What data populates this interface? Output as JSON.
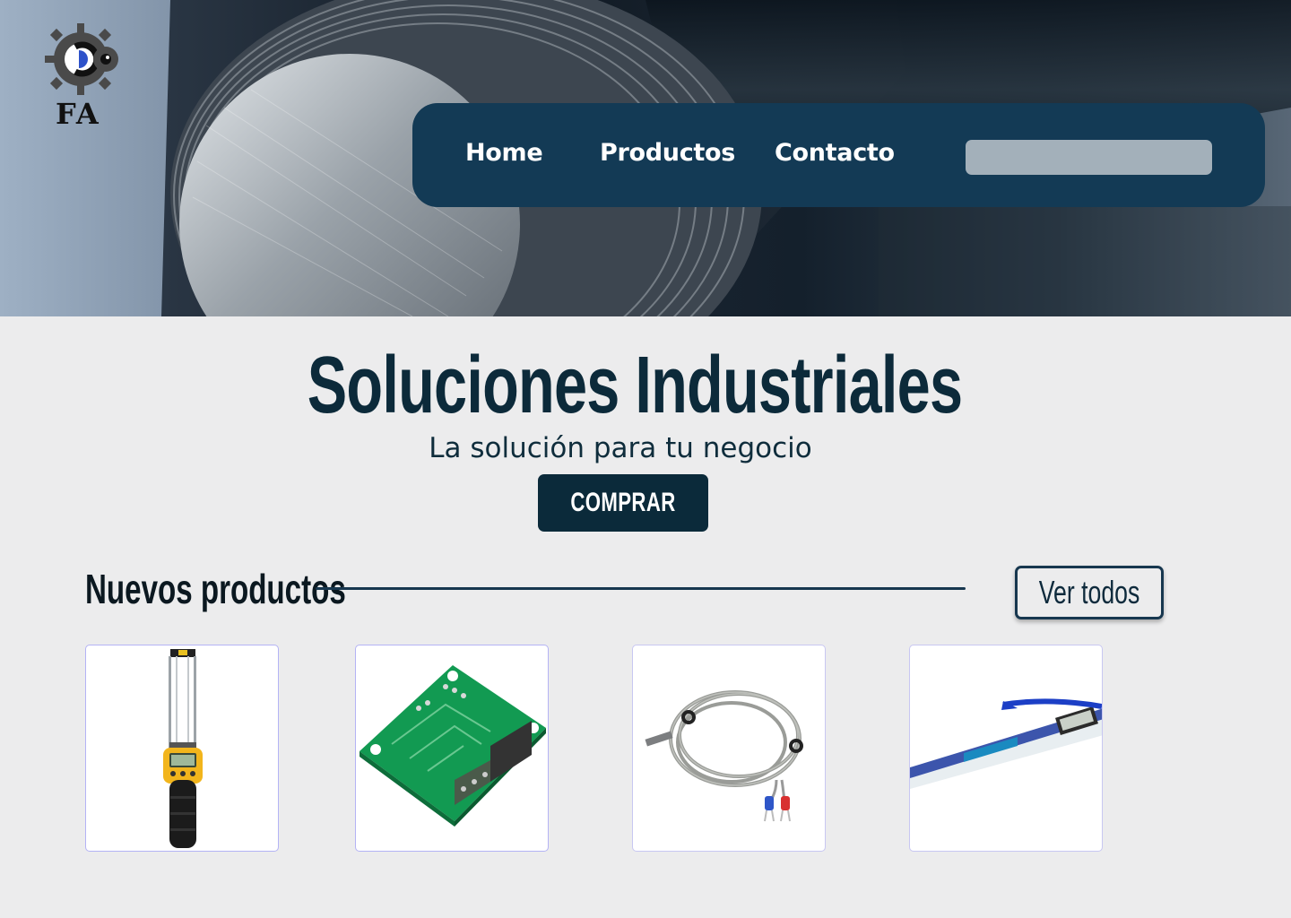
{
  "brand": {
    "logo_text": "FA"
  },
  "nav": {
    "items": [
      {
        "label": "Home"
      },
      {
        "label": "Productos"
      },
      {
        "label": "Contacto"
      }
    ],
    "search": {
      "value": "",
      "placeholder": ""
    }
  },
  "hero": {
    "title": "Soluciones Industriales",
    "subtitle": "La solución para tu negocio",
    "cta_label": "COMPRAR"
  },
  "new_products": {
    "title": "Nuevos productos",
    "see_all_label": "Ver todos",
    "items": [
      {
        "image": "grain-moisture-meter"
      },
      {
        "image": "thermostat-control-board"
      },
      {
        "image": "thermocouple-cable"
      },
      {
        "image": "digital-probe-thermometer"
      }
    ]
  },
  "colors": {
    "nav_bg": "#133a55",
    "primary_dark": "#0b2a3a",
    "page_bg": "#ececed",
    "card_border": "#b4b3f5"
  }
}
